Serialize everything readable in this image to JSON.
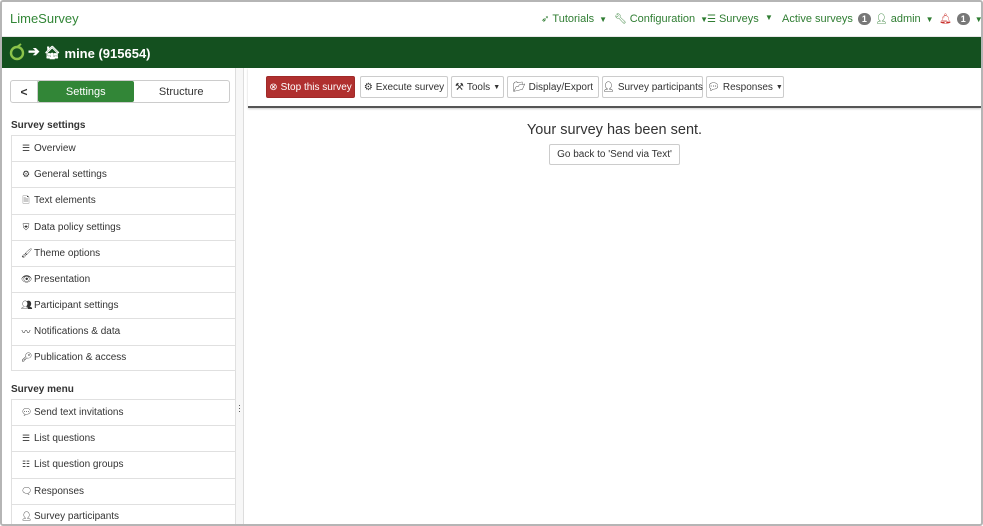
{
  "app": {
    "brand": "LimeSurvey"
  },
  "topnav": {
    "tutorials": "Tutorials",
    "configuration": "Configuration",
    "surveys": "Surveys",
    "active_surveys": "Active surveys",
    "active_surveys_count": "1",
    "admin": "admin",
    "notifications_count": "1"
  },
  "surveybar": {
    "title": "mine (915654)"
  },
  "sidebar": {
    "tabs": [
      "Settings",
      "Structure"
    ],
    "survey_settings_heading": "Survey settings",
    "survey_settings": [
      {
        "label": "Overview",
        "icon": "list-icon"
      },
      {
        "label": "General settings",
        "icon": "gears-icon"
      },
      {
        "label": "Text elements",
        "icon": "file-text-icon"
      },
      {
        "label": "Data policy settings",
        "icon": "shield-icon"
      },
      {
        "label": "Theme options",
        "icon": "paint-brush-icon"
      },
      {
        "label": "Presentation",
        "icon": "eye-icon"
      },
      {
        "label": "Participant settings",
        "icon": "users-icon"
      },
      {
        "label": "Notifications & data",
        "icon": "rss-icon"
      },
      {
        "label": "Publication & access",
        "icon": "key-icon"
      }
    ],
    "survey_menu_heading": "Survey menu",
    "survey_menu": [
      {
        "label": "Send text invitations",
        "icon": "comment-icon"
      },
      {
        "label": "List questions",
        "icon": "list-icon"
      },
      {
        "label": "List question groups",
        "icon": "th-list-icon"
      },
      {
        "label": "Responses",
        "icon": "comment-o-icon"
      },
      {
        "label": "Survey participants",
        "icon": "user-icon"
      }
    ]
  },
  "toolbar": {
    "stop": "Stop this survey",
    "execute": "Execute survey",
    "tools": "Tools",
    "display_export": "Display/Export",
    "participants": "Survey participants",
    "responses": "Responses"
  },
  "main": {
    "message": "Your survey has been sent.",
    "back_button": "Go back to 'Send via Text'"
  },
  "colors": {
    "brand_green": "#328637",
    "dark_green": "#14501f",
    "danger": "#b0302f"
  }
}
